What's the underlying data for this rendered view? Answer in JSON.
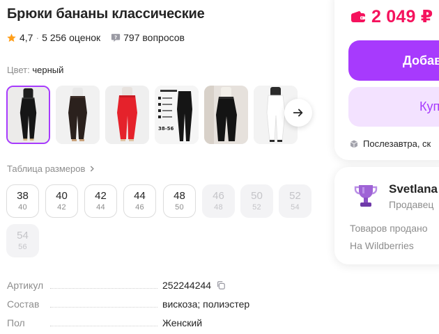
{
  "product": {
    "title": "Брюки бананы классические",
    "rating": "4,7",
    "rating_separator": "·",
    "reviews": "5 256 оценок",
    "questions": "797 вопросов",
    "color_label": "Цвет:",
    "color_value": "черный"
  },
  "thumbnails": [
    {
      "name": "black",
      "active": true
    },
    {
      "name": "dark-brown",
      "active": false
    },
    {
      "name": "red",
      "active": false
    },
    {
      "name": "black-size-chart",
      "active": false
    },
    {
      "name": "black-wide",
      "active": false
    },
    {
      "name": "white",
      "active": false
    }
  ],
  "size_table_link": "Таблица размеров",
  "sizes": [
    {
      "size": "38",
      "ru": "40",
      "available": true
    },
    {
      "size": "40",
      "ru": "42",
      "available": true
    },
    {
      "size": "42",
      "ru": "44",
      "available": true
    },
    {
      "size": "44",
      "ru": "46",
      "available": true
    },
    {
      "size": "48",
      "ru": "50",
      "available": true
    },
    {
      "size": "46",
      "ru": "48",
      "available": false
    },
    {
      "size": "50",
      "ru": "52",
      "available": false
    },
    {
      "size": "52",
      "ru": "54",
      "available": false
    },
    {
      "size": "54",
      "ru": "56",
      "available": false
    }
  ],
  "specs": [
    {
      "key": "Артикул",
      "value": "252244244",
      "copyable": true
    },
    {
      "key": "Состав",
      "value": "вискоза; полиэстер",
      "copyable": false
    },
    {
      "key": "Пол",
      "value": "Женский",
      "copyable": false
    }
  ],
  "buy_panel": {
    "price": "2 049 ₽",
    "add_to_cart_label": "Добав",
    "buy_now_label": "Куп",
    "delivery_text": "Послезавтра, ск"
  },
  "seller": {
    "name": "Svetlana",
    "role": "Продавец",
    "sold_label": "Товаров продано",
    "since_label": "На Wildberries"
  },
  "colors": {
    "accent": "#a73afd",
    "price": "#f5125d",
    "muted_text": "#8d8d8d",
    "star": "#ff9f1a"
  },
  "icons": {
    "rating": "star-icon",
    "questions": "question-bubble-icon",
    "next": "arrow-right-icon",
    "chevron": "chevron-right-icon",
    "copy": "copy-icon",
    "wallet": "wallet-icon",
    "delivery": "box-icon",
    "seller": "trophy-icon"
  }
}
